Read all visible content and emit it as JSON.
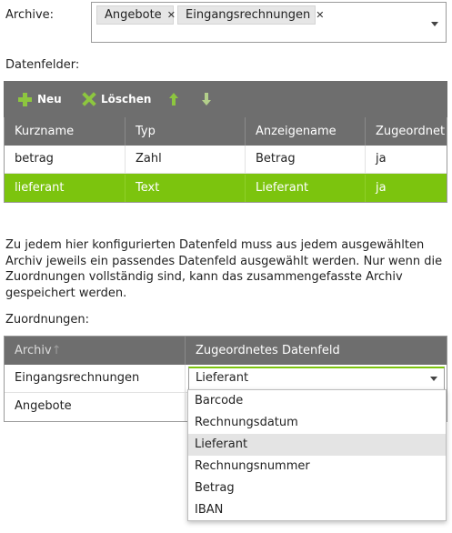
{
  "archive": {
    "label": "Archive:",
    "tags": [
      {
        "label": "Angebote",
        "remove": "✕"
      },
      {
        "label": "Eingangsrechnungen",
        "remove": "✕"
      }
    ]
  },
  "fields": {
    "label": "Datenfelder:",
    "toolbar": {
      "new_label": "Neu",
      "delete_label": "Löschen",
      "up_icon": "arrow-up-icon",
      "down_icon": "arrow-down-icon"
    },
    "columns": [
      "Kurzname",
      "Typ",
      "Anzeigename",
      "Zugeordnet"
    ],
    "rows": [
      {
        "kurzname": "betrag",
        "typ": "Zahl",
        "anzeigename": "Betrag",
        "zugeordnet": "ja"
      },
      {
        "kurzname": "lieferant",
        "typ": "Text",
        "anzeigename": "Lieferant",
        "zugeordnet": "ja"
      }
    ]
  },
  "info": {
    "text": "Zu jedem hier konfigurierten Datenfeld muss aus jedem ausgewählten Archiv jeweils ein passendes Datenfeld ausgewählt werden. Nur wenn die Zuordnungen vollständig sind, kann das zusammengefasste Archiv gespeichert werden."
  },
  "assignments": {
    "label": "Zuordnungen:",
    "columns": {
      "archiv": "Archiv",
      "sort_arrow": "↑",
      "feld": "Zugeordnetes Datenfeld"
    },
    "rows": [
      {
        "archiv": "Eingangsrechnungen",
        "feld": "Lieferant"
      },
      {
        "archiv": "Angebote",
        "feld": ""
      }
    ],
    "dropdown": {
      "options": [
        "Barcode",
        "Rechnungsdatum",
        "Lieferant",
        "Rechnungsnummer",
        "Betrag",
        "IBAN"
      ],
      "highlighted": "Lieferant"
    }
  },
  "colors": {
    "accent": "#7cc40e",
    "icon_green": "#8dc63f",
    "header_bg": "#6e6e6e"
  }
}
